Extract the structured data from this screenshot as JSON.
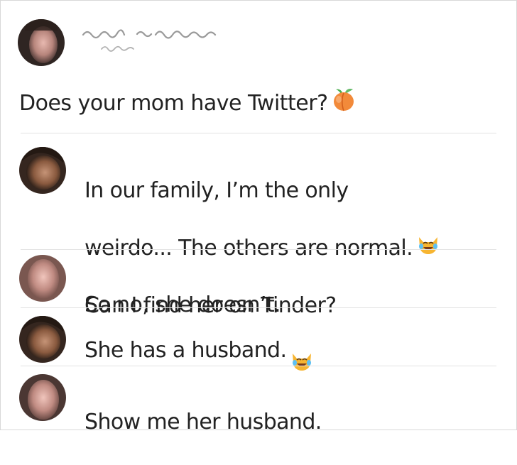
{
  "post": {
    "author_name": "",
    "author_subtitle": "",
    "text": "Does your mom have Twitter?",
    "emoji_icon": "peach-emoji-icon"
  },
  "comments": [
    {
      "lines": [
        "In our family, I’m the only",
        "weirdo... The others are normal.",
        "So no, she doesn’t."
      ],
      "emoji_icon": "cat-tears-of-joy-icon"
    },
    {
      "lines": [
        "Can I find her on Tinder?"
      ]
    },
    {
      "lines": [
        "She has a husband."
      ],
      "emoji_icon": "cat-tears-of-joy-icon"
    },
    {
      "lines": [
        "Show me her husband."
      ]
    }
  ],
  "colors": {
    "text": "#222222",
    "divider": "#e3e3e3",
    "border": "#d8d8d8",
    "peach": "#f28a3a",
    "cat": "#f7b531"
  }
}
